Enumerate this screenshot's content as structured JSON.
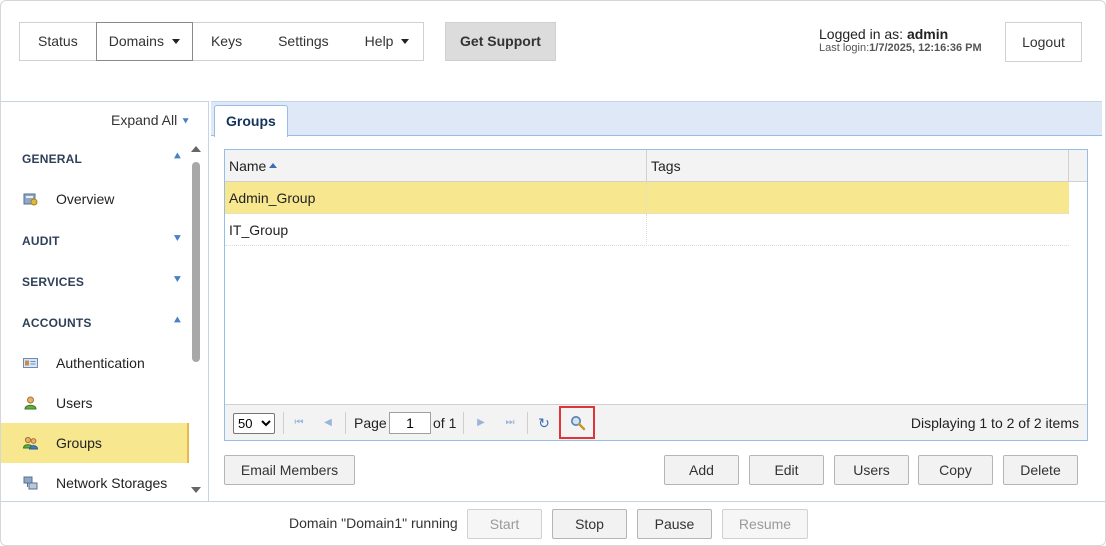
{
  "topnav": {
    "items": [
      {
        "label": "Status"
      },
      {
        "label": "Domains"
      },
      {
        "label": "Keys"
      },
      {
        "label": "Settings"
      },
      {
        "label": "Help"
      }
    ],
    "support_label": "Get Support",
    "logout_label": "Logout"
  },
  "login": {
    "prefix": "Logged in as: ",
    "user": "admin",
    "last_login_prefix": "Last login:",
    "last_login_value": "1/7/2025, 12:16:36 PM"
  },
  "sidebar": {
    "expand_all": "Expand All",
    "sections": [
      {
        "label": "GENERAL",
        "chevron": "collapse-icon"
      },
      {
        "label": "AUDIT",
        "chevron": "expand-icon"
      },
      {
        "label": "SERVICES",
        "chevron": "expand-icon"
      },
      {
        "label": "ACCOUNTS",
        "chevron": "collapse-icon"
      }
    ],
    "items": [
      {
        "label": "Overview",
        "icon": "overview-icon"
      },
      {
        "label": "Authentication",
        "icon": "id-card-icon"
      },
      {
        "label": "Users",
        "icon": "user-icon"
      },
      {
        "label": "Groups",
        "icon": "group-icon",
        "selected": true
      },
      {
        "label": "Network Storages",
        "icon": "network-storage-icon"
      }
    ]
  },
  "main": {
    "tab_label": "Groups",
    "grid": {
      "columns": [
        "Name",
        "Tags"
      ],
      "rows": [
        {
          "name": "Admin_Group",
          "tags": "",
          "selected": true
        },
        {
          "name": "IT_Group",
          "tags": ""
        }
      ]
    },
    "pager": {
      "page_size": "50",
      "page_label": "Page",
      "page_value": "1",
      "of_label": "of 1",
      "displaying": "Displaying 1 to 2 of 2 items"
    },
    "actions": {
      "email_members": "Email Members",
      "add": "Add",
      "edit": "Edit",
      "users": "Users",
      "copy": "Copy",
      "delete": "Delete"
    }
  },
  "bottom": {
    "status": "Domain \"Domain1\" running",
    "start": "Start",
    "stop": "Stop",
    "pause": "Pause",
    "resume": "Resume"
  },
  "colors": {
    "accent": "#4a7fc2",
    "selection": "#f7e78f",
    "highlight_border": "#e0343c"
  }
}
